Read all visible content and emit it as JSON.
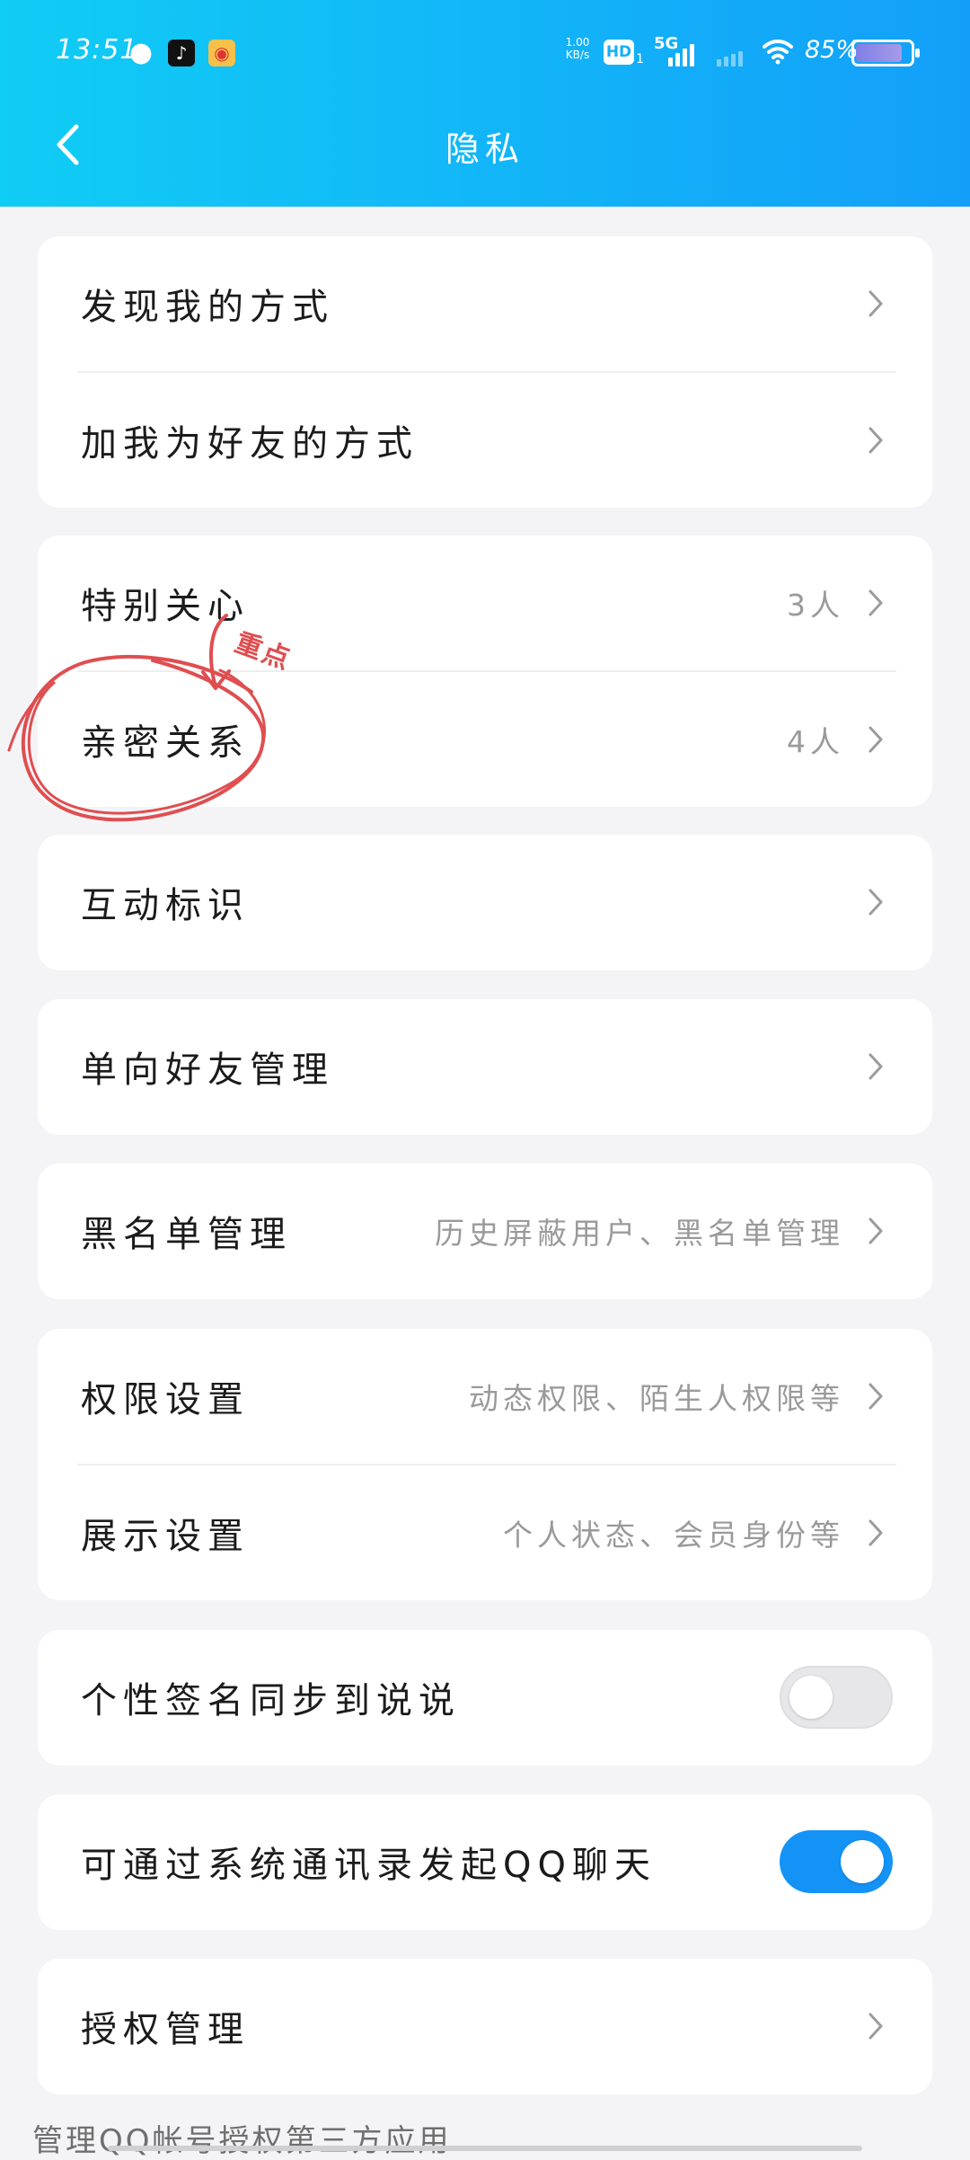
{
  "status_bar": {
    "time": "13:51",
    "net_speed_value": "1.00",
    "net_speed_unit": "KB/s",
    "hd_label": "HD",
    "sim_index": "1",
    "network_type": "5G",
    "battery_percent": "85%",
    "battery_level": 0.85,
    "icons": [
      "wechat-icon",
      "tiktok-icon",
      "weibo-icon",
      "wifi-icon",
      "battery-icon"
    ]
  },
  "header": {
    "title": "隐私"
  },
  "cards": {
    "discover": {
      "rows": [
        {
          "label": "发现我的方式",
          "value": ""
        },
        {
          "label": "加我为好友的方式",
          "value": ""
        }
      ]
    },
    "relations": {
      "rows": [
        {
          "label": "特别关心",
          "value": "3人"
        },
        {
          "label": "亲密关系",
          "value": "4人"
        }
      ]
    },
    "interaction": {
      "rows": [
        {
          "label": "互动标识",
          "value": ""
        }
      ]
    },
    "oneway": {
      "rows": [
        {
          "label": "单向好友管理",
          "value": ""
        }
      ]
    },
    "blacklist": {
      "rows": [
        {
          "label": "黑名单管理",
          "value": "历史屏蔽用户、黑名单管理"
        }
      ]
    },
    "permissions": {
      "rows": [
        {
          "label": "权限设置",
          "value": "动态权限、陌生人权限等"
        },
        {
          "label": "展示设置",
          "value": "个人状态、会员身份等"
        }
      ]
    },
    "signature_sync": {
      "label": "个性签名同步到说说",
      "enabled": false
    },
    "contacts_chat": {
      "label": "可通过系统通讯录发起QQ聊天",
      "enabled": true
    },
    "authorization": {
      "rows": [
        {
          "label": "授权管理",
          "value": ""
        }
      ]
    }
  },
  "footer": {
    "note": "管理QQ帐号授权第三方应用"
  },
  "annotation": {
    "text": "重点",
    "color": "#df4e50"
  },
  "colors": {
    "header_start": "#10cdf5",
    "header_end": "#139ff9",
    "toggle_on": "#1493f7"
  }
}
